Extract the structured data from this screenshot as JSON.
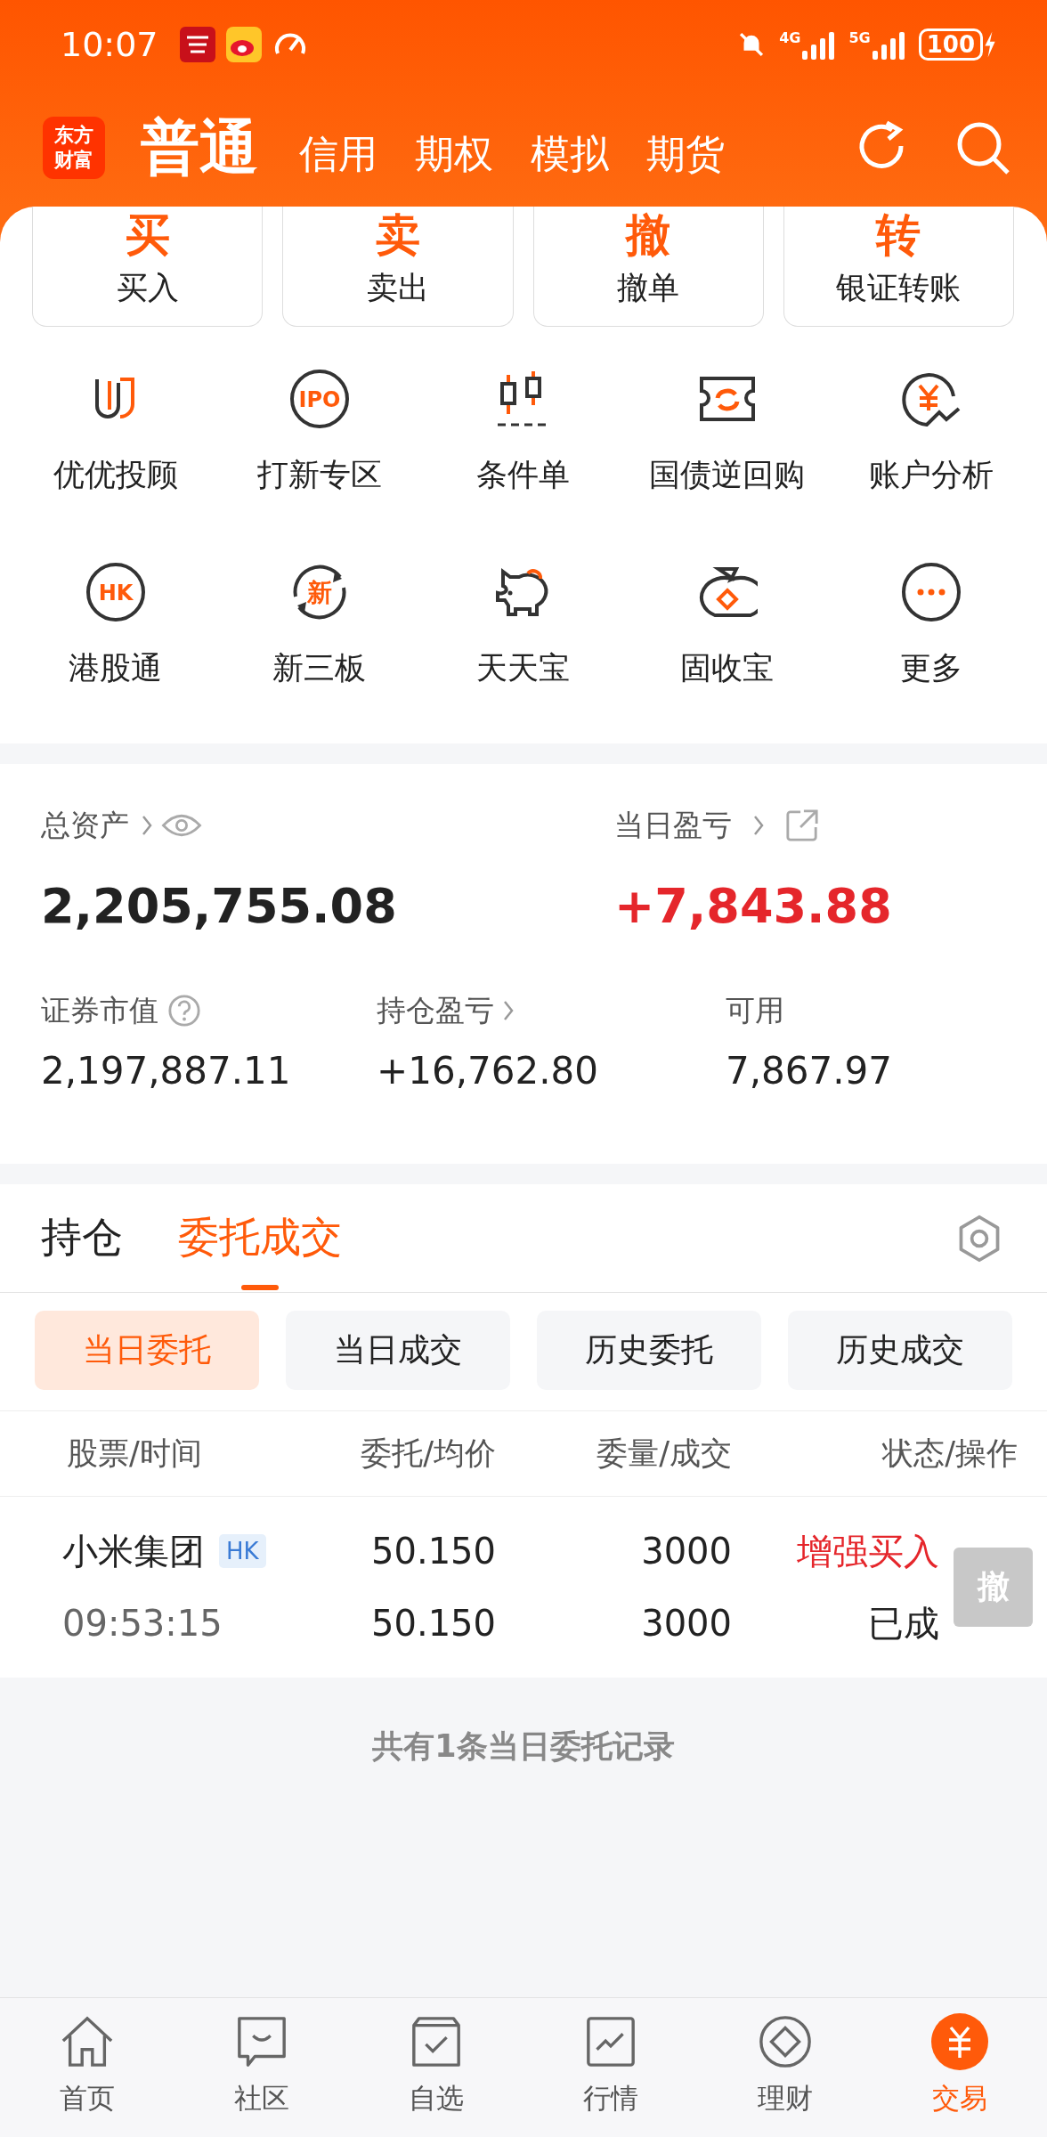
{
  "status_bar": {
    "time": "10:07",
    "network": [
      "4G",
      "5G"
    ],
    "battery": "100"
  },
  "header": {
    "logo": "东方财富",
    "account_tabs": [
      {
        "label": "普通",
        "selected": true
      },
      {
        "label": "信用",
        "selected": false
      },
      {
        "label": "期权",
        "selected": false
      },
      {
        "label": "模拟",
        "selected": false
      },
      {
        "label": "期货",
        "selected": false
      }
    ]
  },
  "quick_actions": [
    {
      "glyph": "买",
      "label": "买入"
    },
    {
      "glyph": "卖",
      "label": "卖出"
    },
    {
      "glyph": "撤",
      "label": "撤单"
    },
    {
      "glyph": "转",
      "label": "银证转账"
    }
  ],
  "services": [
    {
      "kind": "advisor",
      "label": "优优投顾"
    },
    {
      "kind": "badge",
      "icon_text": "IPO",
      "label": "打新专区"
    },
    {
      "kind": "candles",
      "label": "条件单"
    },
    {
      "kind": "ticket",
      "label": "国债逆回购"
    },
    {
      "kind": "yen",
      "label": "账户分析"
    },
    {
      "kind": "badge",
      "icon_text": "HK",
      "label": "港股通"
    },
    {
      "kind": "cycle",
      "icon_text": "新",
      "label": "新三板"
    },
    {
      "kind": "piggy",
      "label": "天天宝"
    },
    {
      "kind": "moneybag",
      "label": "固收宝"
    },
    {
      "kind": "more",
      "label": "更多"
    }
  ],
  "assets": {
    "total": {
      "label": "总资产",
      "value": "2,205,755.08"
    },
    "today_pnl": {
      "label": "当日盈亏",
      "value": "+7,843.88"
    },
    "market_value": {
      "label": "证券市值",
      "value": "2,197,887.11"
    },
    "position_pnl": {
      "label": "持仓盈亏",
      "value": "+16,762.80"
    },
    "available": {
      "label": "可用",
      "value": "7,867.97"
    }
  },
  "section_tabs": [
    {
      "label": "持仓",
      "selected": false
    },
    {
      "label": "委托成交",
      "selected": true
    }
  ],
  "filters": [
    {
      "label": "当日委托",
      "selected": true
    },
    {
      "label": "当日成交",
      "selected": false
    },
    {
      "label": "历史委托",
      "selected": false
    },
    {
      "label": "历史成交",
      "selected": false
    }
  ],
  "table": {
    "columns": [
      "股票/时间",
      "委托/均价",
      "委量/成交",
      "状态/操作"
    ],
    "rows": [
      {
        "name": "小米集团",
        "market": "HK",
        "time": "09:53:15",
        "price": "50.150",
        "avg_price": "50.150",
        "quantity": "3000",
        "filled": "3000",
        "order_type": "增强买入",
        "status": "已成",
        "cancel": "撤",
        "cancel_disabled": true
      }
    ]
  },
  "footer_note": "共有1条当日委托记录",
  "bottom_nav": [
    {
      "kind": "home",
      "label": "首页",
      "selected": false
    },
    {
      "kind": "chat",
      "label": "社区",
      "selected": false
    },
    {
      "kind": "watch",
      "label": "自选",
      "selected": false
    },
    {
      "kind": "chart",
      "label": "行情",
      "selected": false
    },
    {
      "kind": "diamond",
      "label": "理财",
      "selected": false
    },
    {
      "kind": "trade",
      "label": "交易",
      "selected": true
    }
  ]
}
